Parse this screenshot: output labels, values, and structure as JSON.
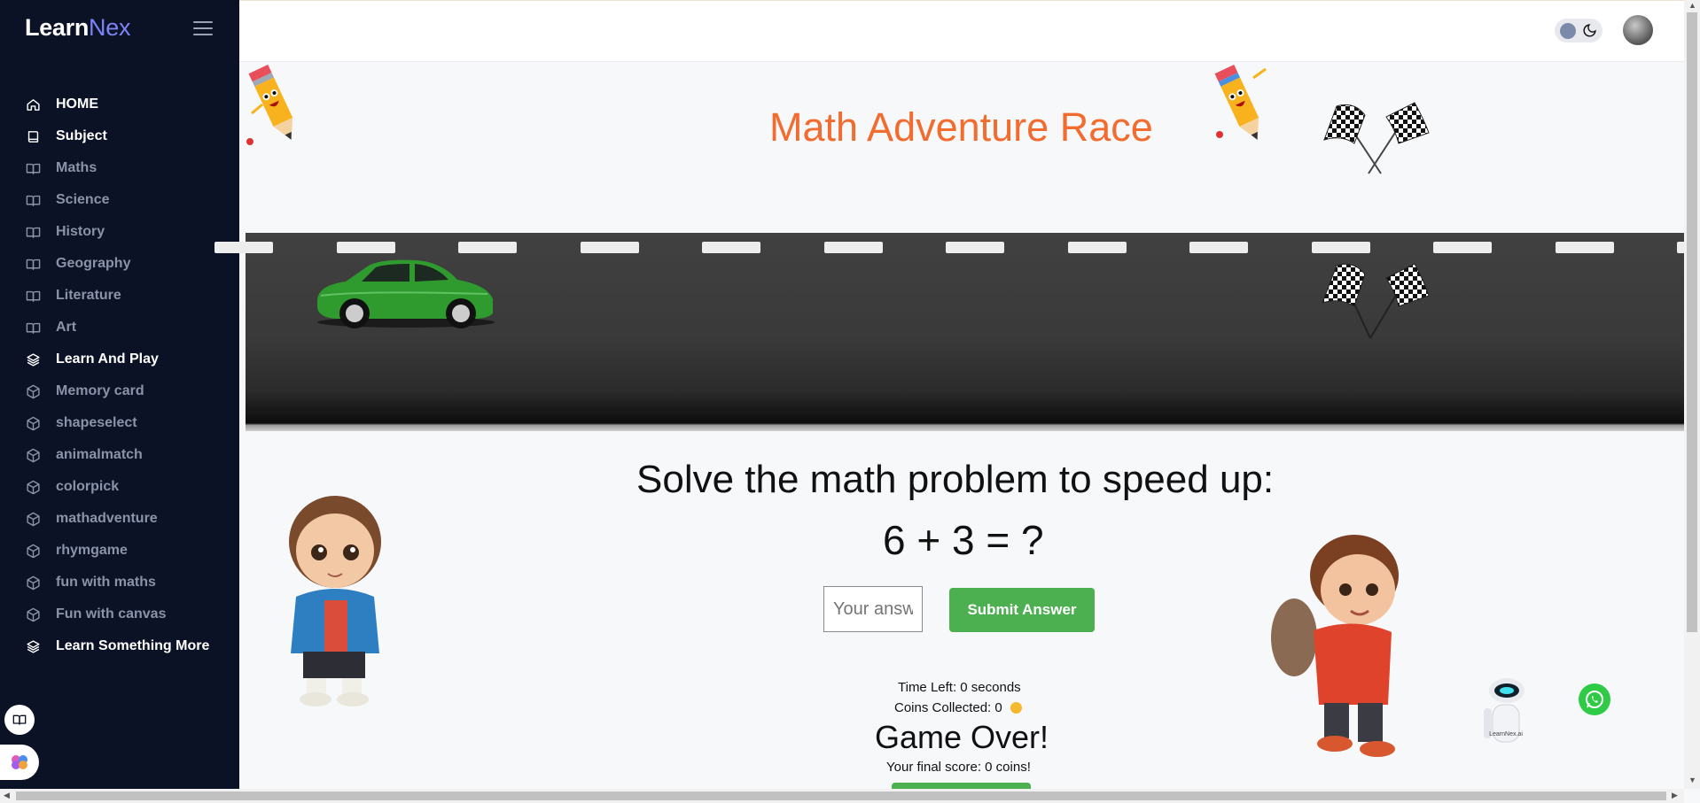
{
  "brand": {
    "part1": "Learn",
    "part2": "Nex"
  },
  "sidebar": {
    "items": [
      {
        "label": "HOME",
        "icon": "home-icon",
        "style": "bold"
      },
      {
        "label": "Subject",
        "icon": "book-icon",
        "style": "bold"
      },
      {
        "label": "Maths",
        "icon": "open-book-icon",
        "style": "dim"
      },
      {
        "label": "Science",
        "icon": "open-book-icon",
        "style": "dim"
      },
      {
        "label": "History",
        "icon": "open-book-icon",
        "style": "dim"
      },
      {
        "label": "Geography",
        "icon": "open-book-icon",
        "style": "dim"
      },
      {
        "label": "Literature",
        "icon": "open-book-icon",
        "style": "dim"
      },
      {
        "label": "Art",
        "icon": "open-book-icon",
        "style": "dim"
      },
      {
        "label": "Learn And Play",
        "icon": "layers-icon",
        "style": "bold"
      },
      {
        "label": "Memory card",
        "icon": "cube-icon",
        "style": "dim"
      },
      {
        "label": "shapeselect",
        "icon": "cube-icon",
        "style": "dim"
      },
      {
        "label": "animalmatch",
        "icon": "cube-icon",
        "style": "dim"
      },
      {
        "label": "colorpick",
        "icon": "cube-icon",
        "style": "dim"
      },
      {
        "label": "mathadventure",
        "icon": "cube-icon",
        "style": "dim"
      },
      {
        "label": "rhymgame",
        "icon": "cube-icon",
        "style": "dim"
      },
      {
        "label": "fun with maths",
        "icon": "cube-icon",
        "style": "dim"
      },
      {
        "label": "Fun with canvas",
        "icon": "cube-icon",
        "style": "dim"
      },
      {
        "label": "Learn Something More",
        "icon": "layers-icon",
        "style": "bold"
      }
    ]
  },
  "game": {
    "title": "Math Adventure Race",
    "prompt": "Solve the math problem to speed up:",
    "question": "6 + 3 = ?",
    "answer_placeholder": "Your answer",
    "answer_value": "",
    "submit_label": "Submit Answer",
    "time_left": "Time Left: 0 seconds",
    "coins": "Coins Collected: 0",
    "game_over": "Game Over!",
    "final_score": "Your final score: 0 coins!"
  },
  "robot_label": "LearnNex.ai",
  "colors": {
    "sidebar_bg": "#0b1226",
    "title_orange": "#f26b2f",
    "button_green": "#4caf50",
    "brand_accent": "#7c83f5"
  }
}
